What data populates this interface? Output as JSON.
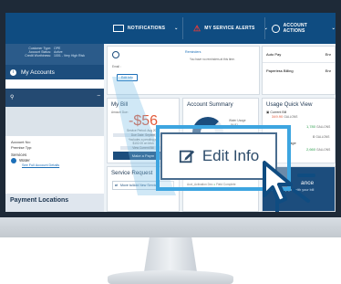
{
  "topnav": {
    "notifications": "NOTIFICATIONS",
    "alerts": "MY SERVICE ALERTS",
    "account_actions": "ACCOUNT ACTIONS"
  },
  "sidebar": {
    "meta": [
      {
        "k": "Customer Type:",
        "v": "OPE"
      },
      {
        "k": "Account Status:",
        "v": "Active"
      },
      {
        "k": "Credit Worthiness:",
        "v": "1001 - Very High Risk"
      }
    ],
    "my_accounts": "My Accounts",
    "account_no": "Account No:",
    "premise_typ": "Premise Typ:",
    "services": "Services",
    "water": "Water",
    "see_details": "See Full Account Details",
    "payment_locations": "Payment Locations"
  },
  "main": {
    "email_label": "Email :",
    "edit_small": "Edit Info",
    "reminders": "Reminders",
    "reminders_sub": "You have no reminders at this time.",
    "autopay": "Auto Pay",
    "autopay_val": "Enr",
    "paperless": "Paperless Billing",
    "paperless_val": "Enr",
    "my_bill": "My Bill",
    "amount_due": "Amount Due:",
    "amount": "-$56",
    "service_period": "Service Period: Aug 20 to",
    "due_date": "Due Date: Septem",
    "note": "*Includes a pending pa",
    "note2": "$102.00 on Mon",
    "view_bill": "View Current Bill",
    "make_payment": "Make a Paym",
    "account_summary": "Account Summary",
    "water_usage": "Water Usage",
    "water_val": "84.81",
    "usage_quick_view": "Usage Quick View",
    "current_bill": "Current Bill",
    "current_val": "349.90",
    "v2": "1,780",
    "v3": "0",
    "v4": "2,660",
    "unit": "GALLONS",
    "usage_word": "age",
    "service_request": "Service Request",
    "move_service": "Move to/Add New Service",
    "date": "May 31, 2022",
    "order": "SR 87201 1070",
    "order_label": "Acct_Activation Dec",
    "field": "Field Complete",
    "advance": "ance",
    "help": "help you with your bill",
    "edit_big": "Edit Info"
  }
}
